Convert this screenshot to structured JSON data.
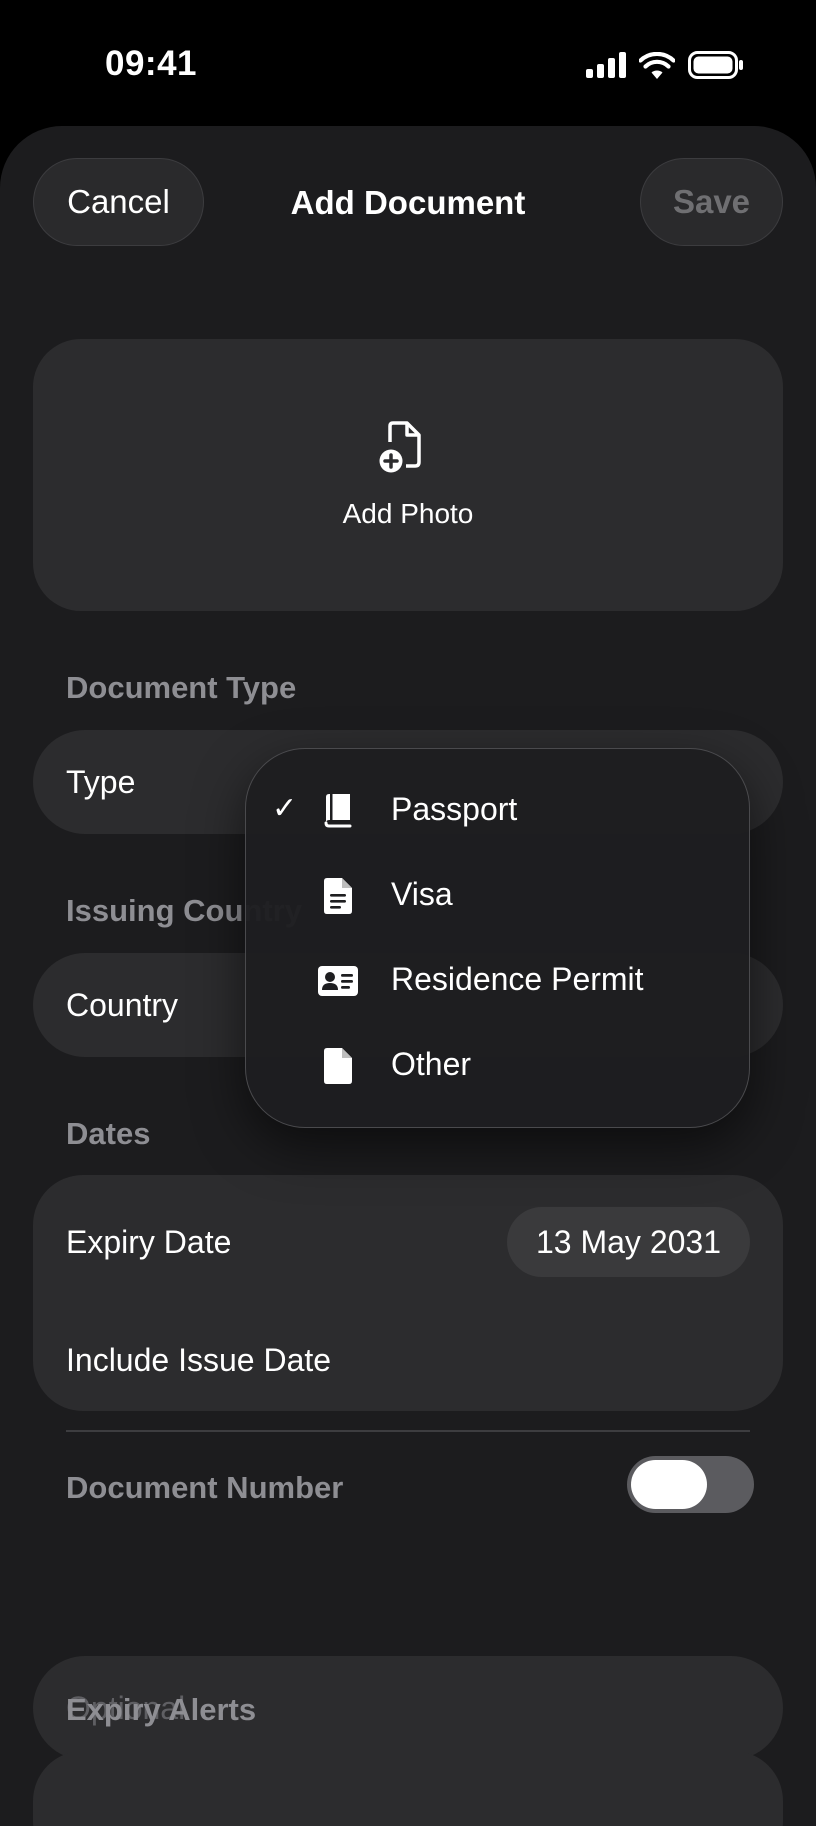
{
  "status_bar": {
    "time": "09:41"
  },
  "nav": {
    "cancel_label": "Cancel",
    "title": "Add Document",
    "save_label": "Save"
  },
  "photo": {
    "label": "Add Photo",
    "icon": "doc-badge-plus-icon"
  },
  "sections": {
    "document_type": "Document Type",
    "issuing_country": "Issuing Country",
    "dates": "Dates",
    "document_number": "Document Number",
    "expiry_alerts": "Expiry Alerts"
  },
  "type_row": {
    "label": "Type"
  },
  "country_row": {
    "label": "Country"
  },
  "dates": {
    "expiry_label": "Expiry Date",
    "expiry_value": "13 May 2031",
    "include_issue_label": "Include Issue Date",
    "include_issue_on": false
  },
  "document_number": {
    "placeholder": "Optional",
    "value": ""
  },
  "type_menu": {
    "selected": "Passport",
    "options": [
      {
        "label": "Passport",
        "icon": "book-icon",
        "checked": true
      },
      {
        "label": "Visa",
        "icon": "doc-text-icon",
        "checked": false
      },
      {
        "label": "Residence Permit",
        "icon": "id-card-icon",
        "checked": false
      },
      {
        "label": "Other",
        "icon": "doc-icon",
        "checked": false
      }
    ],
    "check_glyph": "✓"
  },
  "colors": {
    "background": "#000000",
    "sheet": "#1c1c1e",
    "card": "#2c2c2e",
    "secondary_text": "#8e8e93",
    "disabled_text": "#6f6f72"
  }
}
